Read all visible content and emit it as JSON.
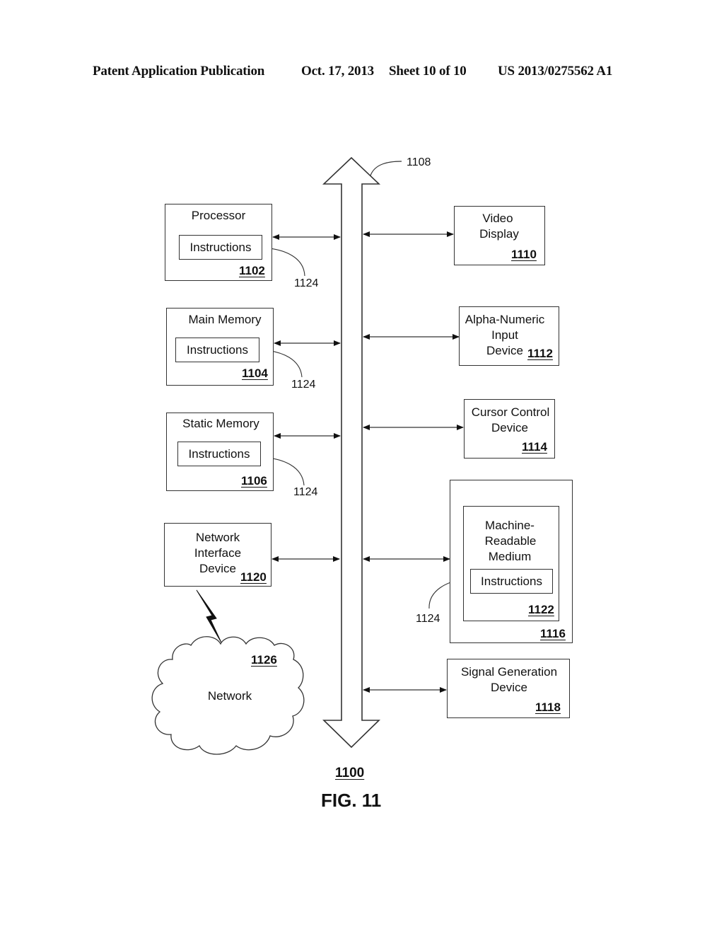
{
  "header": {
    "publication_type": "Patent Application Publication",
    "date": "Oct. 17, 2013",
    "sheet": "Sheet 10 of 10",
    "patent_number": "US 2013/0275562 A1"
  },
  "figure": {
    "ref": "1100",
    "title": "FIG. 11",
    "bus_ref": "1108",
    "instructions_ref": "1124"
  },
  "blocks": {
    "processor": {
      "label": "Processor",
      "inner": "Instructions",
      "ref": "1102"
    },
    "main_memory": {
      "label": "Main Memory",
      "inner": "Instructions",
      "ref": "1104"
    },
    "static_memory": {
      "label": "Static Memory",
      "inner": "Instructions",
      "ref": "1106"
    },
    "network_interface": {
      "line1": "Network",
      "line2": "Interface",
      "line3": "Device",
      "ref": "1120"
    },
    "network": {
      "label": "Network",
      "ref": "1126",
      "icon": "cloud-icon",
      "link_icon": "lightning-icon"
    },
    "video_display": {
      "line1": "Video",
      "line2": "Display",
      "ref": "1110"
    },
    "alpha_numeric": {
      "line1": "Alpha-Numeric",
      "line2": "Input",
      "line3": "Device",
      "ref": "1112"
    },
    "cursor_control": {
      "line1": "Cursor Control",
      "line2": "Device",
      "ref": "1114"
    },
    "drive_unit": {
      "ref": "1116"
    },
    "machine_readable": {
      "line1": "Machine-",
      "line2": "Readable",
      "line3": "Medium",
      "inner": "Instructions",
      "ref": "1122"
    },
    "signal_generation": {
      "line1": "Signal Generation",
      "line2": "Device",
      "ref": "1118"
    }
  }
}
